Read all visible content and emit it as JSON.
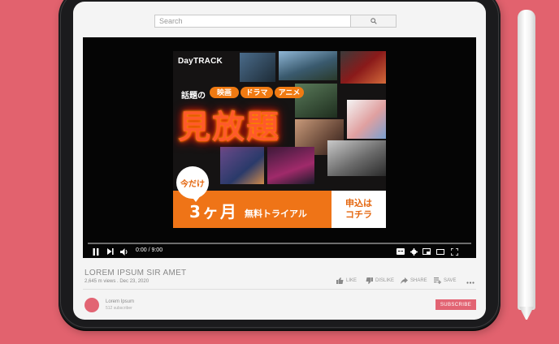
{
  "search": {
    "placeholder": "Search"
  },
  "ad": {
    "brand": "DayTRACK",
    "topic_prefix": "話題の",
    "tags": [
      "映画",
      "ドラマ",
      "アニメ"
    ],
    "headline": "見放題",
    "badge": "今だけ",
    "offer": "3ヶ月",
    "offer_sub": "無料トライアル",
    "cta_line1": "申込は",
    "cta_line2": "コチラ"
  },
  "player": {
    "time": "0:00 / 9:00",
    "progress": 0
  },
  "video": {
    "title": "LOREM IPSUM SIR AMET",
    "meta": "2,645 m views  .  Dec 23, 2020",
    "actions": [
      "LIKE",
      "DISLIKE",
      "SHARE",
      "SAVE"
    ]
  },
  "channel": {
    "name": "Lorem Ipsum",
    "subscribers": "512 subscriber"
  },
  "subscribe_label": "SUBSCRIBE",
  "colors": {
    "accent": "#e26473",
    "background": "#e2626e",
    "ad_orange": "#ef7417"
  }
}
